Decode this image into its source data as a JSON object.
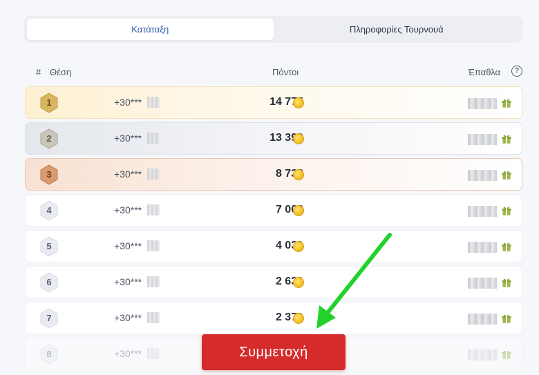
{
  "tabs": [
    {
      "label": "Κατάταξη",
      "active": true
    },
    {
      "label": "Πληροφορίες Τουρνουά",
      "active": false
    }
  ],
  "table_header": {
    "hash": "#",
    "position": "Θέση",
    "points": "Πόντοι",
    "prizes": "Έπαθλα",
    "help": "?"
  },
  "rows": [
    {
      "rank": "1",
      "player": "+30***",
      "points": "14 775",
      "style": "gold"
    },
    {
      "rank": "2",
      "player": "+30***",
      "points": "13 399",
      "style": "silver"
    },
    {
      "rank": "3",
      "player": "+30***",
      "points": "8 732",
      "style": "bronze"
    },
    {
      "rank": "4",
      "player": "+30***",
      "points": "7 003",
      "style": "plain"
    },
    {
      "rank": "5",
      "player": "+30***",
      "points": "4 031",
      "style": "plain"
    },
    {
      "rank": "6",
      "player": "+30***",
      "points": "2 631",
      "style": "plain"
    },
    {
      "rank": "7",
      "player": "+30***",
      "points": "2 371",
      "style": "plain"
    },
    {
      "rank": "8",
      "player": "+30***",
      "points": "",
      "style": "faded"
    }
  ],
  "cta_label": "Συμμετοχή",
  "colors": {
    "accent_blue": "#2f5fae",
    "cta_red": "#d62b2b",
    "gold": "#c9a24a",
    "silver": "#b7b2a4",
    "bronze": "#c4865a",
    "arrow_green": "#22d22a"
  },
  "icons": {
    "coin": "coin-icon",
    "gift": "gift-icon",
    "help": "help-icon",
    "arrow": "green-arrow"
  }
}
